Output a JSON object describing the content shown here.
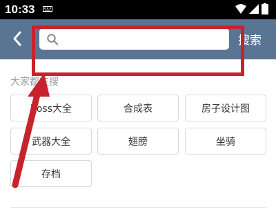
{
  "status_bar": {
    "time": "10:33",
    "icons": [
      "keyboard-icon",
      "wifi-icon",
      "signal-icon",
      "battery-icon"
    ]
  },
  "header": {
    "back_icon": "chevron-left-icon",
    "search_icon": "search-icon",
    "search_placeholder": "",
    "search_value": "",
    "search_button_label": "搜索",
    "background_color": "#5a7594"
  },
  "hot_searches": {
    "title": "大家都在搜",
    "tags": [
      "boss大全",
      "合成表",
      "房子设计图",
      "武器大全",
      "翅膀",
      "坐骑",
      "存档"
    ]
  },
  "annotation": {
    "color": "#c8232c",
    "shapes": [
      "highlight-box",
      "arrow"
    ]
  }
}
